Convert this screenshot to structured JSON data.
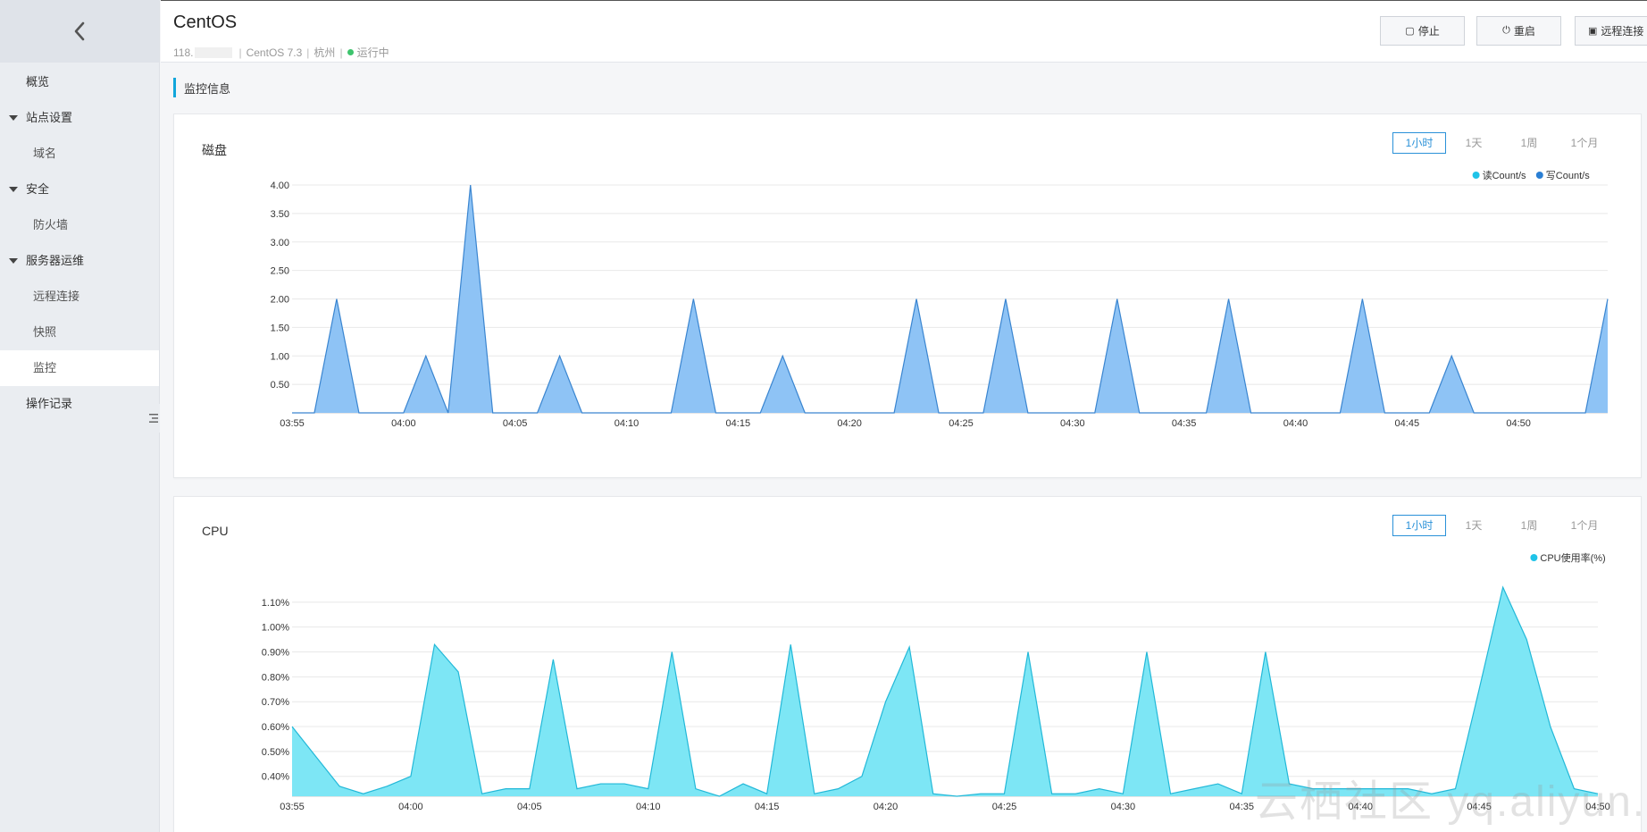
{
  "sidebar": {
    "back_icon": "chevron-left-icon",
    "items": [
      {
        "label": "概览",
        "level": 0,
        "active": false
      },
      {
        "label": "站点设置",
        "level": 0,
        "group": true,
        "active": false
      },
      {
        "label": "域名",
        "level": 1,
        "active": false
      },
      {
        "label": "安全",
        "level": 0,
        "group": true,
        "active": false
      },
      {
        "label": "防火墙",
        "level": 1,
        "active": false
      },
      {
        "label": "服务器运维",
        "level": 0,
        "group": true,
        "active": false
      },
      {
        "label": "远程连接",
        "level": 1,
        "active": false
      },
      {
        "label": "快照",
        "level": 1,
        "active": false
      },
      {
        "label": "监控",
        "level": 1,
        "active": true
      },
      {
        "label": "操作记录",
        "level": 0,
        "active": false
      }
    ]
  },
  "header": {
    "title": "CentOS",
    "ip_prefix": "118.",
    "os": "CentOS 7.3",
    "region": "杭州",
    "status": "运行中",
    "status_color": "#3ec46d",
    "buttons": {
      "stop": "停止",
      "restart": "重启",
      "remote": "远程连接"
    }
  },
  "section": {
    "title": "监控信息",
    "accent": "#11a6db"
  },
  "range_tabs": [
    "1小时",
    "1天",
    "1周",
    "1个月"
  ],
  "watermark": "云栖社区 yq.aliyun.com",
  "chart_data": [
    {
      "type": "area",
      "title": "磁盘",
      "selected_range": "1小时",
      "legend": [
        {
          "name": "读Count/s",
          "color": "#1fc3e8"
        },
        {
          "name": "写Count/s",
          "color": "#2a7fd4"
        }
      ],
      "legend_position": "top-right",
      "x": [
        "03:55",
        "03:56",
        "03:57",
        "03:58",
        "03:59",
        "04:00",
        "04:01",
        "04:02",
        "04:03",
        "04:04",
        "04:05",
        "04:06",
        "04:07",
        "04:08",
        "04:09",
        "04:10",
        "04:11",
        "04:12",
        "04:13",
        "04:14",
        "04:15",
        "04:16",
        "04:17",
        "04:18",
        "04:19",
        "04:20",
        "04:21",
        "04:22",
        "04:23",
        "04:24",
        "04:25",
        "04:26",
        "04:27",
        "04:28",
        "04:29",
        "04:30",
        "04:31",
        "04:32",
        "04:33",
        "04:34",
        "04:35",
        "04:36",
        "04:37",
        "04:38",
        "04:39",
        "04:40",
        "04:41",
        "04:42",
        "04:43",
        "04:44",
        "04:45",
        "04:46",
        "04:47",
        "04:48",
        "04:49",
        "04:50",
        "04:51",
        "04:52",
        "04:53",
        "04:54"
      ],
      "series": [
        {
          "name": "写Count/s",
          "values": [
            0,
            0,
            2,
            0,
            0,
            0,
            1,
            0,
            4,
            0,
            0,
            0,
            1,
            0,
            0,
            0,
            0,
            0,
            2,
            0,
            0,
            0,
            1,
            0,
            0,
            0,
            0,
            0,
            2,
            0,
            0,
            0,
            2,
            0,
            0,
            0,
            0,
            2,
            0,
            0,
            0,
            0,
            2,
            0,
            0,
            0,
            0,
            0,
            2,
            0,
            0,
            0,
            1,
            0,
            0,
            0,
            0,
            0,
            0,
            2
          ]
        }
      ],
      "x_ticks": [
        "03:55",
        "04:00",
        "04:05",
        "04:10",
        "04:15",
        "04:20",
        "04:25",
        "04:30",
        "04:35",
        "04:40",
        "04:45",
        "04:50"
      ],
      "y_ticks": [
        "0.50",
        "1.00",
        "1.50",
        "2.00",
        "2.50",
        "3.00",
        "3.50",
        "4.00"
      ],
      "ylim": [
        0,
        4
      ],
      "grid": true
    },
    {
      "type": "area",
      "title": "CPU",
      "selected_range": "1小时",
      "legend": [
        {
          "name": "CPU使用率(%)",
          "color": "#1fc3e8"
        }
      ],
      "legend_position": "top-right",
      "x": [
        "03:55",
        "03:56",
        "03:57",
        "03:58",
        "03:59",
        "04:00",
        "04:01",
        "04:02",
        "04:03",
        "04:04",
        "04:05",
        "04:06",
        "04:07",
        "04:08",
        "04:09",
        "04:10",
        "04:11",
        "04:12",
        "04:13",
        "04:14",
        "04:15",
        "04:16",
        "04:17",
        "04:18",
        "04:19",
        "04:20",
        "04:21",
        "04:22",
        "04:23",
        "04:24",
        "04:25",
        "04:26",
        "04:27",
        "04:28",
        "04:29",
        "04:30",
        "04:31",
        "04:32",
        "04:33",
        "04:34",
        "04:35",
        "04:36",
        "04:37",
        "04:38",
        "04:39",
        "04:40",
        "04:41",
        "04:42",
        "04:43",
        "04:44",
        "04:45",
        "04:46",
        "04:47",
        "04:48",
        "04:49",
        "04:50"
      ],
      "series": [
        {
          "name": "CPU使用率(%)",
          "values": [
            0.6,
            0.48,
            0.36,
            0.33,
            0.36,
            0.4,
            0.93,
            0.82,
            0.33,
            0.35,
            0.35,
            0.87,
            0.35,
            0.37,
            0.37,
            0.35,
            0.9,
            0.35,
            0.32,
            0.37,
            0.33,
            0.93,
            0.33,
            0.35,
            0.4,
            0.7,
            0.92,
            0.33,
            0.32,
            0.33,
            0.33,
            0.9,
            0.33,
            0.33,
            0.35,
            0.33,
            0.9,
            0.33,
            0.35,
            0.37,
            0.33,
            0.9,
            0.37,
            0.35,
            0.35,
            0.35,
            0.35,
            0.35,
            0.33,
            0.35,
            0.75,
            1.16,
            0.95,
            0.6,
            0.35,
            0.33
          ]
        }
      ],
      "x_ticks": [
        "03:55",
        "04:00",
        "04:05",
        "04:10",
        "04:15",
        "04:20",
        "04:25",
        "04:30",
        "04:35",
        "04:40",
        "04:45",
        "04:50"
      ],
      "y_ticks": [
        "0.40%",
        "0.50%",
        "0.60%",
        "0.70%",
        "0.80%",
        "0.90%",
        "1.00%",
        "1.10%"
      ],
      "ylim": [
        0.32,
        1.2
      ],
      "grid": true
    }
  ]
}
